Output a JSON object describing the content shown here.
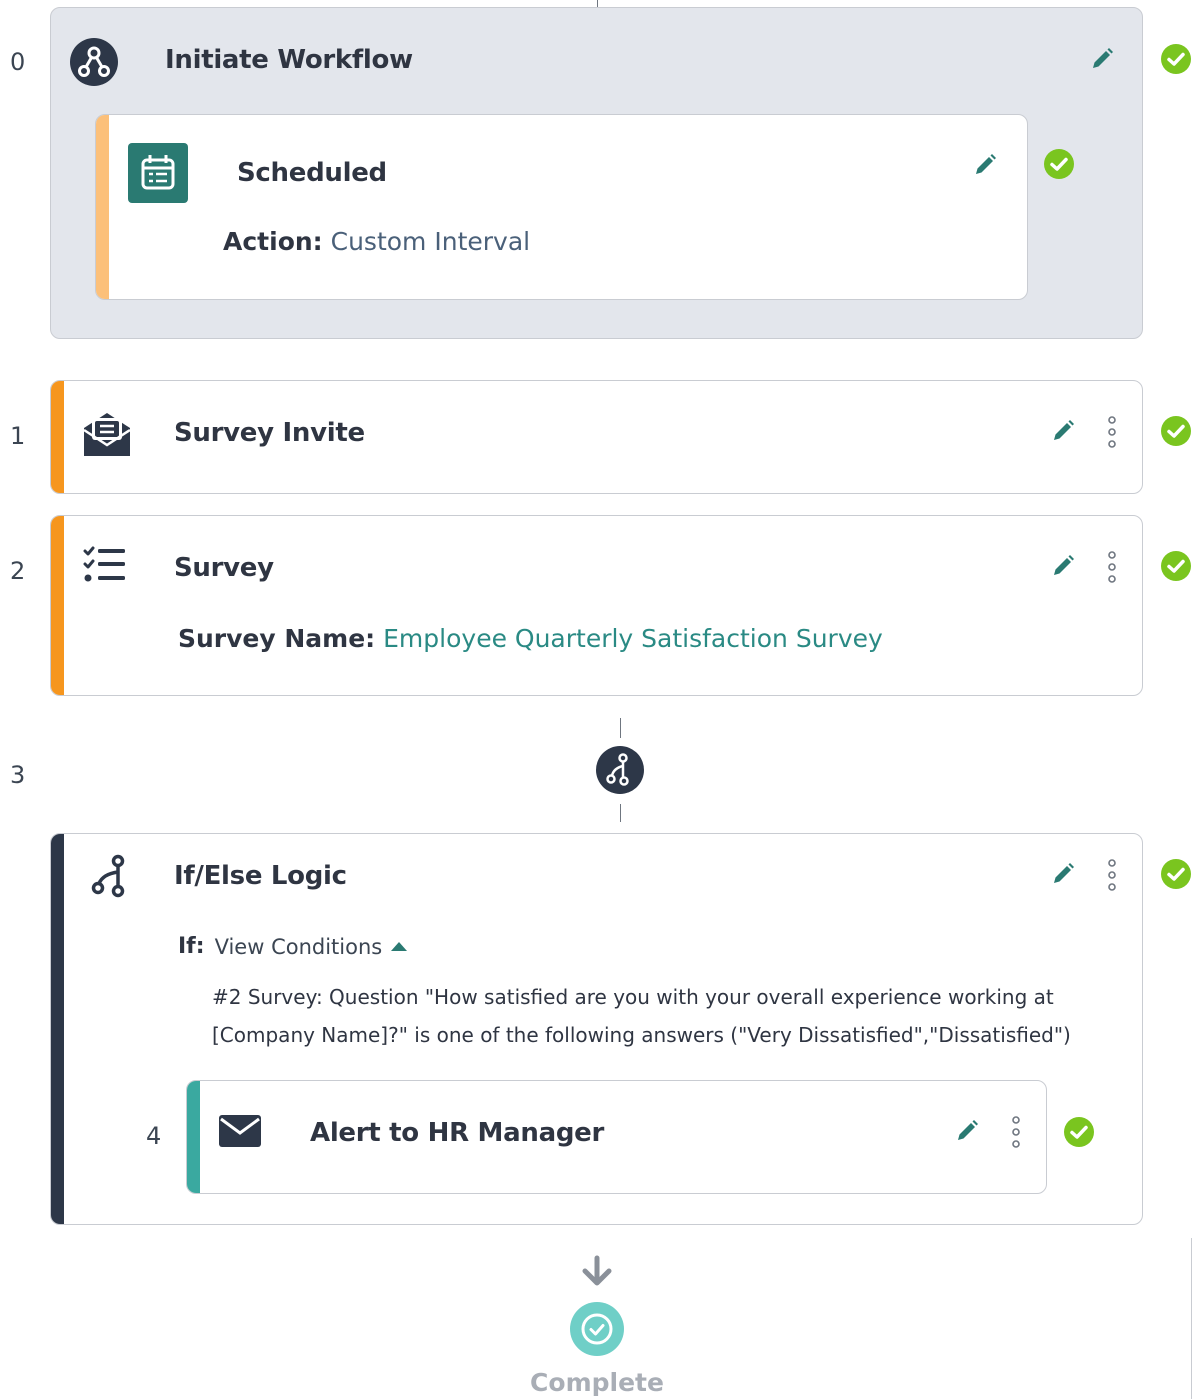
{
  "steps": [
    {
      "number": "0",
      "title": "Initiate Workflow",
      "icon": "workflow-nodes-icon",
      "trigger": {
        "title": "Scheduled",
        "icon": "calendar-icon",
        "action_label": "Action:",
        "action_value": "Custom Interval"
      }
    },
    {
      "number": "1",
      "title": "Survey Invite",
      "icon": "envelope-open-icon"
    },
    {
      "number": "2",
      "title": "Survey",
      "icon": "checklist-icon",
      "name_label": "Survey Name:",
      "name_value": "Employee Quarterly Satisfaction Survey"
    },
    {
      "number": "3",
      "connector_icon": "branch-icon"
    },
    {
      "title": "If/Else Logic",
      "icon": "branch-icon",
      "if_label": "If:",
      "view_conditions": "View Conditions",
      "condition_line1": "#2 Survey: Question \"How satisfied are you with your overall experience working at",
      "condition_line2": "[Company Name]?\" is one of the following answers (\"Very Dissatisfied\",\"Dissatisfied\")",
      "nested": {
        "number": "4",
        "title": "Alert to HR Manager",
        "icon": "envelope-icon"
      }
    }
  ],
  "complete_label": "Complete",
  "colors": {
    "accent_orange": "#f6961e",
    "accent_orange_light": "#fcc07a",
    "accent_teal": "#3aa9a0",
    "accent_dark": "#2d3748",
    "check_green": "#7ac51f",
    "icon_teal": "#2a7a72",
    "complete_teal": "#6fcfc7",
    "panel_grey": "#e3e6ec"
  }
}
